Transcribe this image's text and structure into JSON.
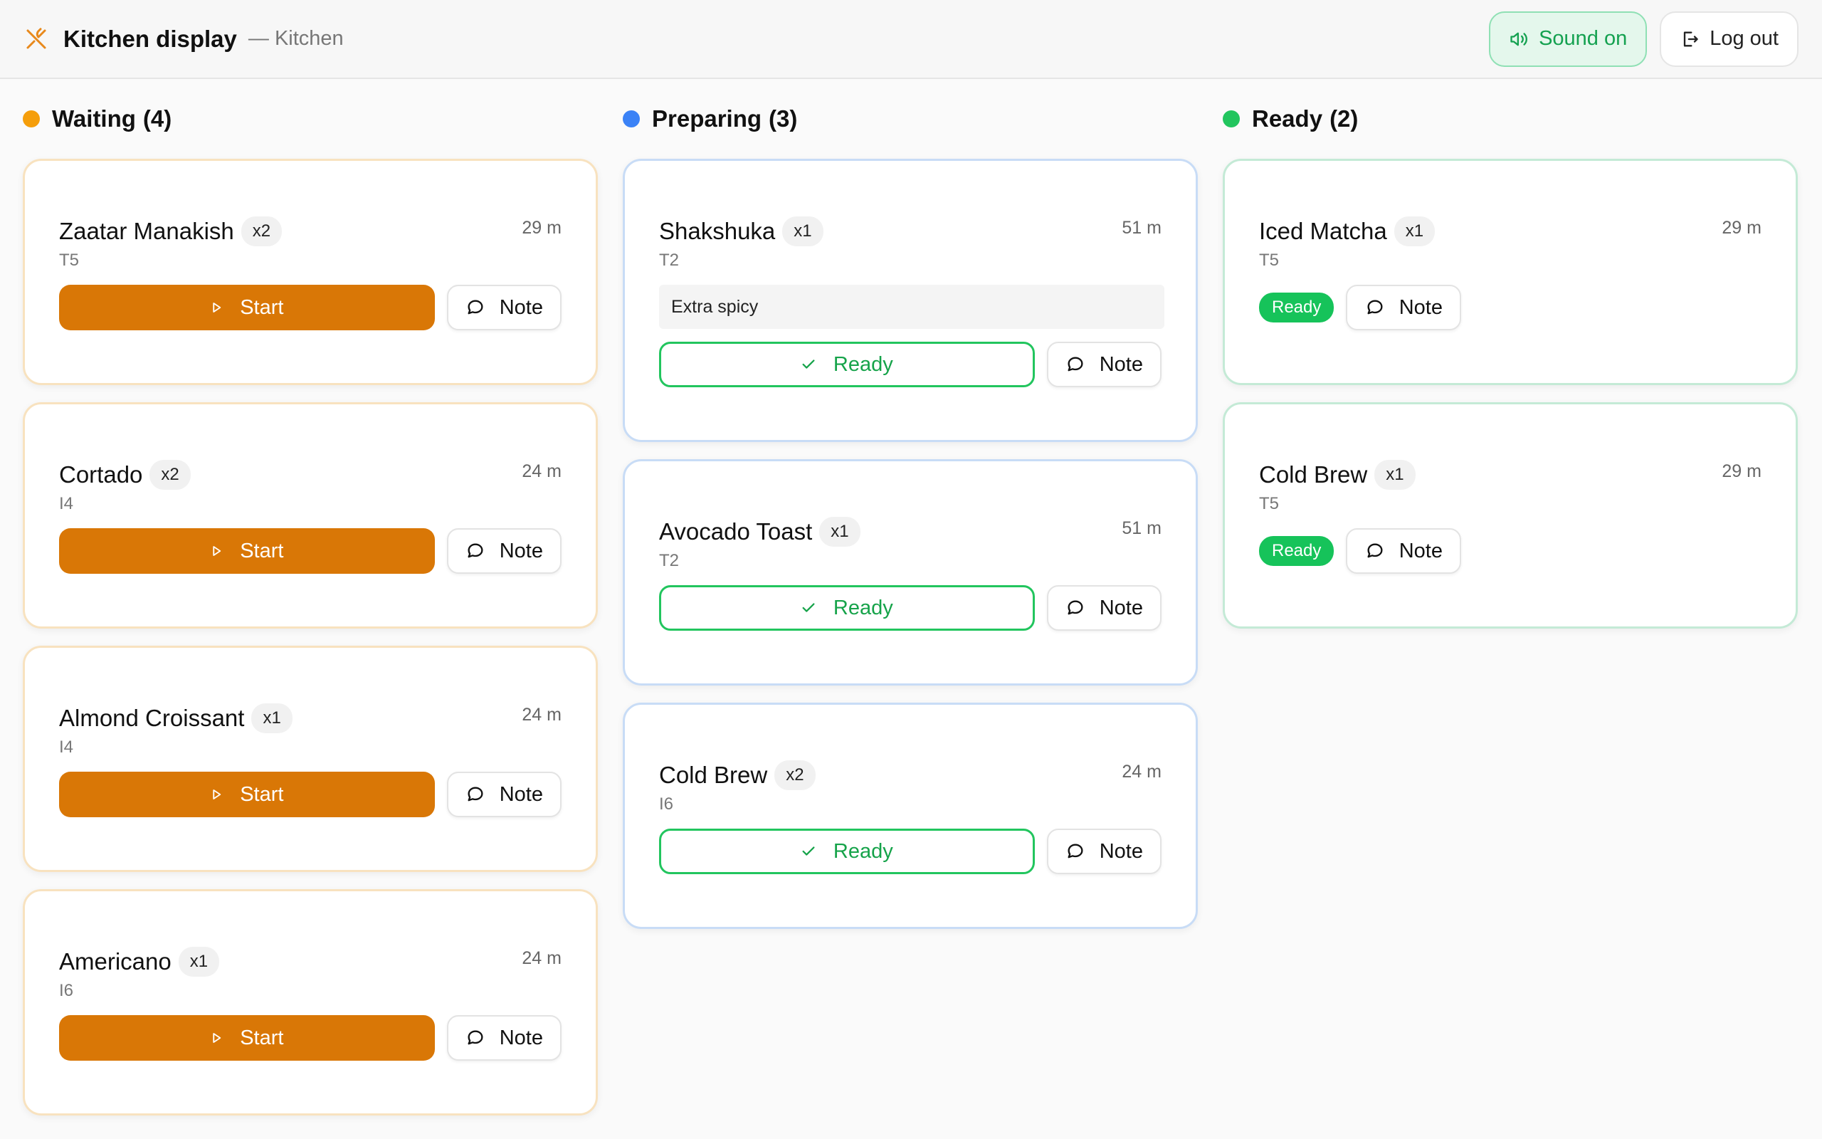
{
  "header": {
    "title": "Kitchen display",
    "subtitle": "— Kitchen",
    "sound_label": "Sound on",
    "logout_label": "Log out"
  },
  "colors": {
    "waiting": "#f59e0b",
    "preparing": "#3b82f6",
    "ready": "#22c55e",
    "start_button": "#d97706",
    "brand_icon": "#e8891c"
  },
  "columns": {
    "waiting": {
      "title": "Waiting",
      "count": "(4)",
      "cards": [
        {
          "name": "Zaatar Manakish",
          "qty": "x2",
          "table": "T5",
          "time": "29 m",
          "action": "Start",
          "note": "Note"
        },
        {
          "name": "Cortado",
          "qty": "x2",
          "table": "I4",
          "time": "24 m",
          "action": "Start",
          "note": "Note"
        },
        {
          "name": "Almond Croissant",
          "qty": "x1",
          "table": "I4",
          "time": "24 m",
          "action": "Start",
          "note": "Note"
        },
        {
          "name": "Americano",
          "qty": "x1",
          "table": "I6",
          "time": "24 m",
          "action": "Start",
          "note": "Note"
        }
      ]
    },
    "preparing": {
      "title": "Preparing",
      "count": "(3)",
      "cards": [
        {
          "name": "Shakshuka",
          "qty": "x1",
          "table": "T2",
          "time": "51 m",
          "comment": "Extra spicy",
          "action": "Ready",
          "note": "Note"
        },
        {
          "name": "Avocado Toast",
          "qty": "x1",
          "table": "T2",
          "time": "51 m",
          "action": "Ready",
          "note": "Note"
        },
        {
          "name": "Cold Brew",
          "qty": "x2",
          "table": "I6",
          "time": "24 m",
          "action": "Ready",
          "note": "Note"
        }
      ]
    },
    "ready": {
      "title": "Ready",
      "count": "(2)",
      "cards": [
        {
          "name": "Iced Matcha",
          "qty": "x1",
          "table": "T5",
          "time": "29 m",
          "status": "Ready",
          "note": "Note"
        },
        {
          "name": "Cold Brew",
          "qty": "x1",
          "table": "T5",
          "time": "29 m",
          "status": "Ready",
          "note": "Note"
        }
      ]
    }
  }
}
